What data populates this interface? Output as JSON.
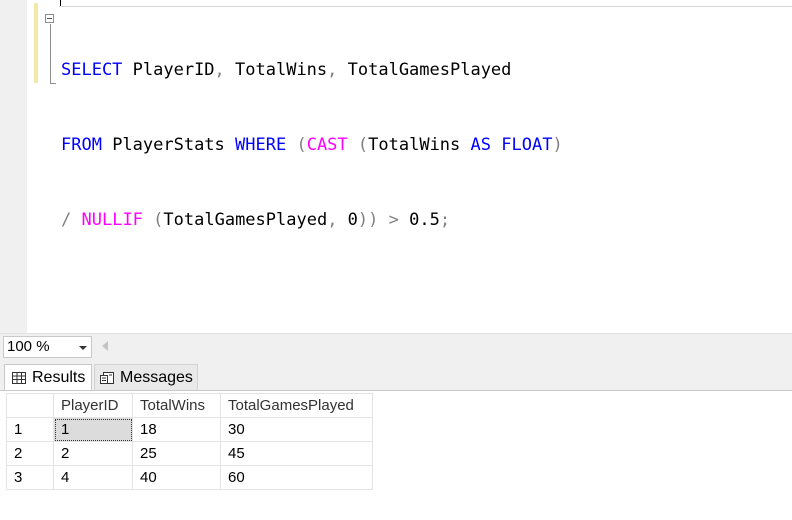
{
  "editor": {
    "lines": [
      [
        {
          "t": "SELECT",
          "c": "kw"
        },
        {
          "t": " PlayerID",
          "c": ""
        },
        {
          "t": ",",
          "c": "op"
        },
        {
          "t": " TotalWins",
          "c": ""
        },
        {
          "t": ",",
          "c": "op"
        },
        {
          "t": " TotalGamesPlayed",
          "c": ""
        }
      ],
      [
        {
          "t": "FROM",
          "c": "kw"
        },
        {
          "t": " PlayerStats ",
          "c": ""
        },
        {
          "t": "WHERE",
          "c": "kw"
        },
        {
          "t": " ",
          "c": ""
        },
        {
          "t": "(",
          "c": "op"
        },
        {
          "t": "CAST",
          "c": "fn"
        },
        {
          "t": " ",
          "c": ""
        },
        {
          "t": "(",
          "c": "op"
        },
        {
          "t": "TotalWins ",
          "c": ""
        },
        {
          "t": "AS",
          "c": "kw"
        },
        {
          "t": " ",
          "c": ""
        },
        {
          "t": "FLOAT",
          "c": "kw"
        },
        {
          "t": ")",
          "c": "op"
        }
      ],
      [
        {
          "t": "/",
          "c": "op"
        },
        {
          "t": " ",
          "c": ""
        },
        {
          "t": "NULLIF",
          "c": "fn"
        },
        {
          "t": " ",
          "c": ""
        },
        {
          "t": "(",
          "c": "op"
        },
        {
          "t": "TotalGamesPlayed",
          "c": ""
        },
        {
          "t": ",",
          "c": "op"
        },
        {
          "t": " 0",
          "c": ""
        },
        {
          "t": "))",
          "c": "op"
        },
        {
          "t": " ",
          "c": ""
        },
        {
          "t": ">",
          "c": "op"
        },
        {
          "t": " 0.5",
          "c": ""
        },
        {
          "t": ";",
          "c": "op"
        }
      ]
    ]
  },
  "zoom": {
    "value": "100 %"
  },
  "tabs": {
    "results": "Results",
    "messages": "Messages"
  },
  "grid": {
    "columns": [
      "PlayerID",
      "TotalWins",
      "TotalGamesPlayed"
    ],
    "rows": [
      {
        "n": "1",
        "cells": [
          "1",
          "18",
          "30"
        ]
      },
      {
        "n": "2",
        "cells": [
          "2",
          "25",
          "45"
        ]
      },
      {
        "n": "3",
        "cells": [
          "4",
          "40",
          "60"
        ]
      }
    ]
  },
  "colors": {
    "keyword": "#0000ff",
    "function": "#ff00ff",
    "operator": "#808080"
  },
  "icons": {
    "collapse": "collapse-minus-icon",
    "results": "grid-icon",
    "messages": "messages-icon",
    "zoom": "chevron-down-icon"
  }
}
